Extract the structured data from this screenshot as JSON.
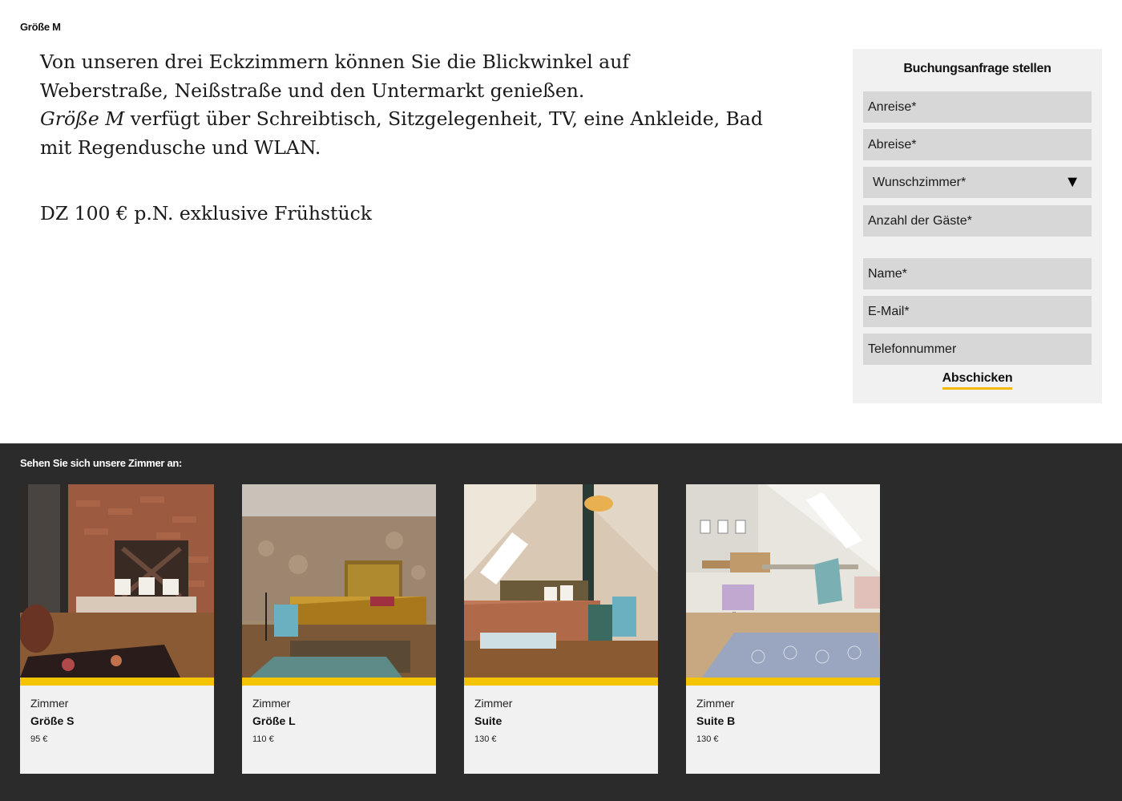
{
  "page": {
    "label": "Größe M"
  },
  "description": {
    "line1": "Von unseren drei Eckzimmern können Sie die Blickwinkel auf",
    "line2": "Weberstraße, Neißstraße und den Untermarkt genießen.",
    "room_name": "Größe M",
    "line3_rest": " verfügt über Schreibtisch, Sitzgelegenheit, TV, eine Ankleide, Bad",
    "line4": "mit Regendusche und WLAN.",
    "price": "DZ 100 € p.N. exklusive Frühstück"
  },
  "booking": {
    "title": "Buchungsanfrage stellen",
    "arrival": "Anreise*",
    "departure": "Abreise*",
    "room_select": "Wunschzimmer*",
    "room_select_icon": "dropdown-triangle",
    "guests": "Anzahl der Gäste*",
    "name": "Name*",
    "email": "E-Mail*",
    "phone": "Telefonnummer",
    "submit": "Abschicken"
  },
  "rooms": {
    "heading": "Sehen Sie sich unsere Zimmer an:",
    "cards": [
      {
        "kind": "Zimmer",
        "name": "Größe S",
        "price": "95 €"
      },
      {
        "kind": "Zimmer",
        "name": "Größe L",
        "price": "110 €"
      },
      {
        "kind": "Zimmer",
        "name": "Suite",
        "price": "130 €"
      },
      {
        "kind": "Zimmer",
        "name": "Suite B",
        "price": "130 €"
      }
    ]
  },
  "colors": {
    "accent": "#f5c400",
    "dark_section": "#2b2b2b",
    "form_bg": "#f1f1f1",
    "field_bg": "#d7d7d7"
  }
}
